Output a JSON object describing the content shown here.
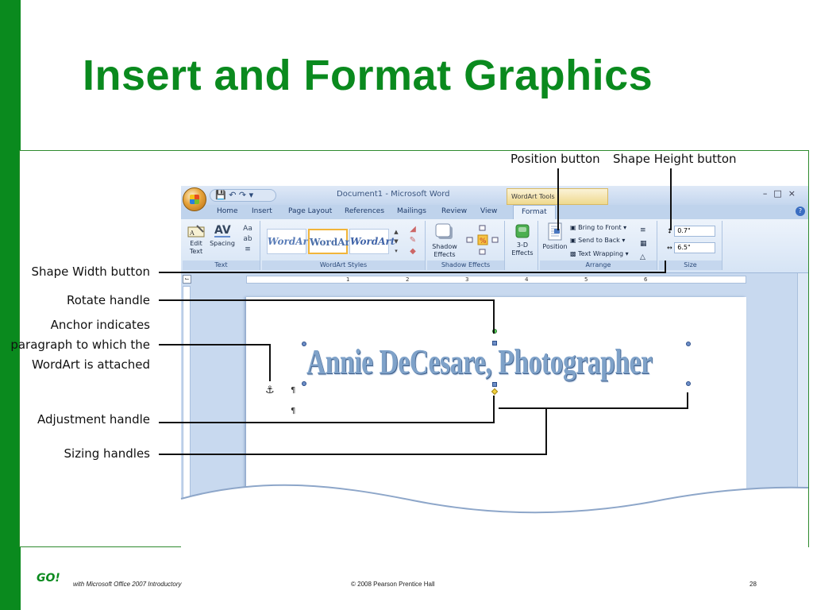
{
  "slide": {
    "title": "Insert and Format Graphics",
    "footer_left": "with Microsoft Office 2007 Introductory",
    "footer_center": "© 2008 Pearson Prentice Hall",
    "page_number": "28",
    "logo_text": "GO!"
  },
  "callouts": {
    "position_button": "Position button",
    "shape_height_button": "Shape Height button",
    "shape_width_button": "Shape Width button",
    "rotate_handle": "Rotate handle",
    "anchor_line1": "Anchor indicates",
    "anchor_line2": "paragraph to which the",
    "anchor_line3": "WordArt is attached",
    "adjustment_handle": "Adjustment handle",
    "sizing_handles": "Sizing handles"
  },
  "window": {
    "title": "Document1 - Microsoft Word",
    "context_tab": "WordArt Tools",
    "tabs": [
      "Home",
      "Insert",
      "Page Layout",
      "References",
      "Mailings",
      "Review",
      "View",
      "Format"
    ],
    "active_tab": "Format"
  },
  "ribbon": {
    "text_group": {
      "label": "Text",
      "edit_text": "Edit Text",
      "spacing": "Spacing"
    },
    "wordart_styles": {
      "label": "WordArt Styles",
      "style1": "WordArt",
      "style2": "WordArt",
      "style3": "WordArt"
    },
    "shadow_effects": {
      "label": "Shadow Effects",
      "button": "Shadow Effects"
    },
    "three_d": {
      "label": "3-D Effects",
      "button": "3-D Effects"
    },
    "arrange": {
      "label": "Arrange",
      "position": "Position",
      "bring_to_front": "Bring to Front",
      "send_to_back": "Send to Back",
      "text_wrapping": "Text Wrapping"
    },
    "size": {
      "label": "Size",
      "height": "0.7\"",
      "width": "6.5\""
    }
  },
  "document": {
    "wordart_text": "Annie DeCesare, Photographer",
    "ruler_numbers": [
      "1",
      "2",
      "3",
      "4",
      "5",
      "6"
    ]
  },
  "colors": {
    "accent_green": "#0a8a1e",
    "ribbon_blue": "#d6e4f5"
  }
}
